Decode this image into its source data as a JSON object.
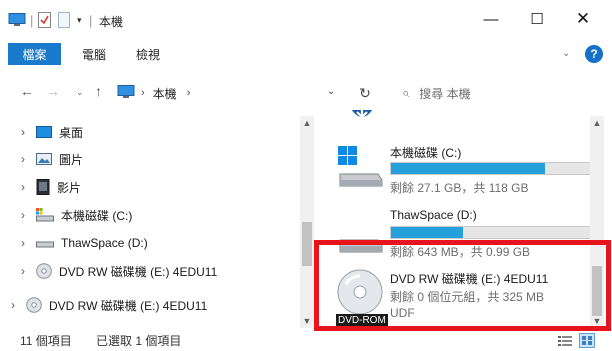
{
  "window": {
    "title": "本機",
    "qa_separator": "|",
    "qa_dropdown": "▾",
    "minimize": "—",
    "maximize": "☐",
    "close": "✕"
  },
  "ribbon": {
    "tabs": [
      {
        "label": "檔案"
      },
      {
        "label": "電腦"
      },
      {
        "label": "檢視"
      }
    ],
    "expand": "⌄",
    "help": "?"
  },
  "address": {
    "back": "←",
    "forward": "→",
    "recent": "⌄",
    "up": "↑",
    "sep": "›",
    "path": "本機",
    "dropdown": "⌄",
    "refresh": "↻",
    "search_icon": "⌕",
    "search_placeholder": "搜尋 本機"
  },
  "nav_pane": {
    "items": [
      {
        "label": "桌面",
        "chevron": "›",
        "icon": "desktop-icon"
      },
      {
        "label": "圖片",
        "chevron": "›",
        "icon": "pictures-icon"
      },
      {
        "label": "影片",
        "chevron": "›",
        "icon": "videos-icon"
      },
      {
        "label": "本機磁碟 (C:)",
        "chevron": "›",
        "icon": "hard-drive-icon"
      },
      {
        "label": "ThawSpace (D:)",
        "chevron": "›",
        "icon": "drive-icon"
      },
      {
        "label": "DVD RW 磁碟機 (E:) 4EDU11",
        "chevron": "›",
        "icon": "dvd-icon"
      }
    ],
    "outer_item": {
      "label": "DVD RW 磁碟機 (E:) 4EDU11",
      "chevron": "›",
      "icon": "dvd-icon"
    },
    "scroll_up": "▲",
    "scroll_down": "▼"
  },
  "drives": [
    {
      "name": "本機磁碟 (C:)",
      "sub": "剩餘 27.1 GB，共 118 GB",
      "used_fraction": 0.77,
      "bar_color": "#26a0da"
    },
    {
      "name": "ThawSpace (D:)",
      "sub": "剩餘 643 MB，共 0.99 GB",
      "used_fraction": 0.36,
      "bar_color": "#26a0da"
    },
    {
      "name": "DVD RW 磁碟機 (E:) 4EDU11",
      "sub": "剩餘 0 個位元組，共 325 MB",
      "sub2": "UDF",
      "badge": "DVD-ROM"
    }
  ],
  "status": {
    "item_count": "11 個項目",
    "selected": "已選取 1 個項目"
  },
  "colors": {
    "accent": "#1979ca",
    "highlight": "#e8141b",
    "bar_fill": "#26a0da"
  }
}
